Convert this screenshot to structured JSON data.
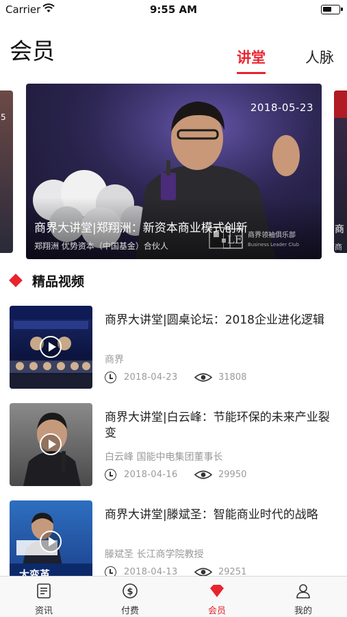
{
  "status_bar": {
    "carrier": "Carrier",
    "time": "9:55 AM"
  },
  "header": {
    "title": "会员",
    "tabs": [
      {
        "label": "讲堂",
        "active": true
      },
      {
        "label": "人脉",
        "active": false
      }
    ]
  },
  "carousel": {
    "left_peek_text": "5",
    "right_peek_title": "商",
    "right_peek_sub": "商",
    "banner": {
      "date": "2018-05-23",
      "title": "商界大讲堂|郑翔洲：新资本商业模式创新",
      "subtitle": "郑翔洲  优势资本（中国基金）合伙人",
      "logo_text": "商界领袖俱乐部",
      "logo_sub": "Business Leader Club"
    }
  },
  "section": {
    "title": "精品视频"
  },
  "videos": [
    {
      "title": "商界大讲堂|圆桌论坛：2018企业进化逻辑",
      "author": "商界",
      "date": "2018-04-23",
      "views": "31808"
    },
    {
      "title": "商界大讲堂|白云峰：节能环保的未来产业裂变",
      "author": "白云峰  国能中电集团董事长",
      "date": "2018-04-16",
      "views": "29950"
    },
    {
      "title": "商界大讲堂|滕斌圣：智能商业时代的战略",
      "author": "滕斌圣  长江商学院教授",
      "date": "2018-04-13",
      "views": "29251"
    }
  ],
  "tab_bar": {
    "items": [
      {
        "label": "资讯",
        "icon": "news-icon"
      },
      {
        "label": "付费",
        "icon": "dollar-coin-icon"
      },
      {
        "label": "会员",
        "icon": "diamond-icon"
      },
      {
        "label": "我的",
        "icon": "user-icon"
      }
    ],
    "active_index": 2
  },
  "colors": {
    "accent": "#e8242d",
    "text": "#222222",
    "muted": "#9a9a9a"
  }
}
